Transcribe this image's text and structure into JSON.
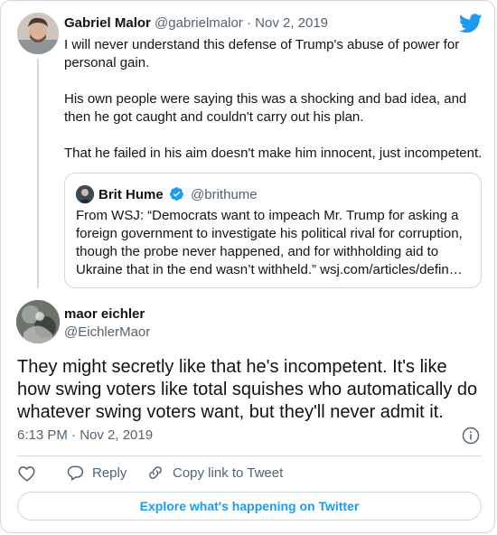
{
  "parent_tweet": {
    "author_name": "Gabriel Malor",
    "handle": "@gabrielmalor",
    "separator": "·",
    "date": "Nov 2, 2019",
    "paragraphs": [
      "I will never understand this defense of Trump's abuse of power for personal gain.",
      "His own people were saying this was a shocking and bad idea, and then he got caught and couldn't carry out his plan.",
      "That he failed in his aim doesn't make him innocent, just incompetent."
    ]
  },
  "quoted_tweet": {
    "author_name": "Brit Hume",
    "handle": "@brithume",
    "lines": [
      "From WSJ: “Democrats want to impeach Mr. Trump for asking a",
      "foreign government to investigate his political rival for corruption,",
      "though the probe never happened, and for withholding aid to",
      "Ukraine that in the end wasn’t withheld.” wsj.com/articles/defin…"
    ]
  },
  "main_tweet": {
    "author_name": "maor eichler",
    "handle": "@EichlerMaor",
    "text": "They might secretly like that he's incompetent. It's like how swing voters like total squishes who automatically do whatever swing voters want, but they'll never admit it.",
    "timestamp": "6:13 PM · Nov 2, 2019"
  },
  "actions": {
    "reply": "Reply",
    "copy_link": "Copy link to Tweet"
  },
  "explore_button": "Explore what's happening on Twitter",
  "icons": {
    "brand": "twitter-bird-icon",
    "verified": "verified-badge-icon",
    "info": "info-icon",
    "like": "heart-icon",
    "reply": "reply-bubble-icon",
    "copy": "link-icon"
  },
  "colors": {
    "accent": "#1d9bf0",
    "text": "#0f1419",
    "muted": "#536471",
    "border": "#cfd9de"
  }
}
